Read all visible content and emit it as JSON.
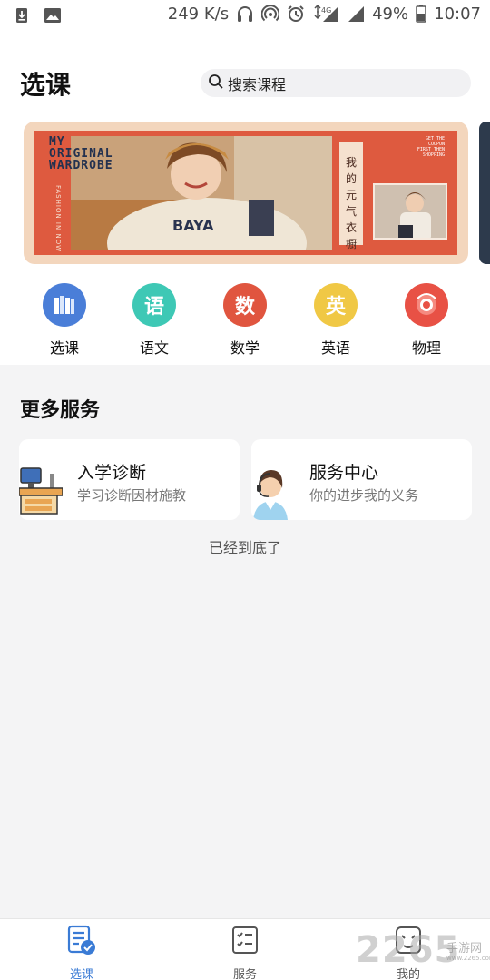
{
  "status_bar": {
    "speed": "249 K/s",
    "network": "4G",
    "battery": "49%",
    "time": "10:07"
  },
  "header": {
    "title": "选课",
    "search_placeholder": "搜索课程"
  },
  "banner": {
    "headline": [
      "MY",
      "ORIGINAL",
      "WARDROBE"
    ],
    "side_text": "FASHION IN NOW",
    "vertical_text": [
      "我",
      "的",
      "元",
      "气",
      "衣",
      "橱"
    ],
    "tags": [
      "GET THE",
      "COUPON",
      "FIRST THEN",
      "SHOPPING"
    ]
  },
  "categories": [
    {
      "label": "选课",
      "glyph": "",
      "color": "#4a7ed8"
    },
    {
      "label": "语文",
      "glyph": "语",
      "color": "#3ec8b5"
    },
    {
      "label": "数学",
      "glyph": "数",
      "color": "#e0553f"
    },
    {
      "label": "英语",
      "glyph": "英",
      "color": "#f0c845"
    },
    {
      "label": "物理",
      "glyph": "",
      "color": "#e85145"
    }
  ],
  "services": {
    "title": "更多服务",
    "cards": [
      {
        "title": "入学诊断",
        "subtitle": "学习诊断因材施教"
      },
      {
        "title": "服务中心",
        "subtitle": "你的进步我的义务"
      }
    ],
    "end_note": "已经到底了"
  },
  "tabbar": {
    "tabs": [
      {
        "label": "选课",
        "active": true
      },
      {
        "label": "服务",
        "active": false
      },
      {
        "label": "我的",
        "active": false
      }
    ],
    "accent": "#3a7bd5"
  },
  "watermark": {
    "brand": "2265",
    "text": "手游网",
    "url": "www.2265.com"
  }
}
